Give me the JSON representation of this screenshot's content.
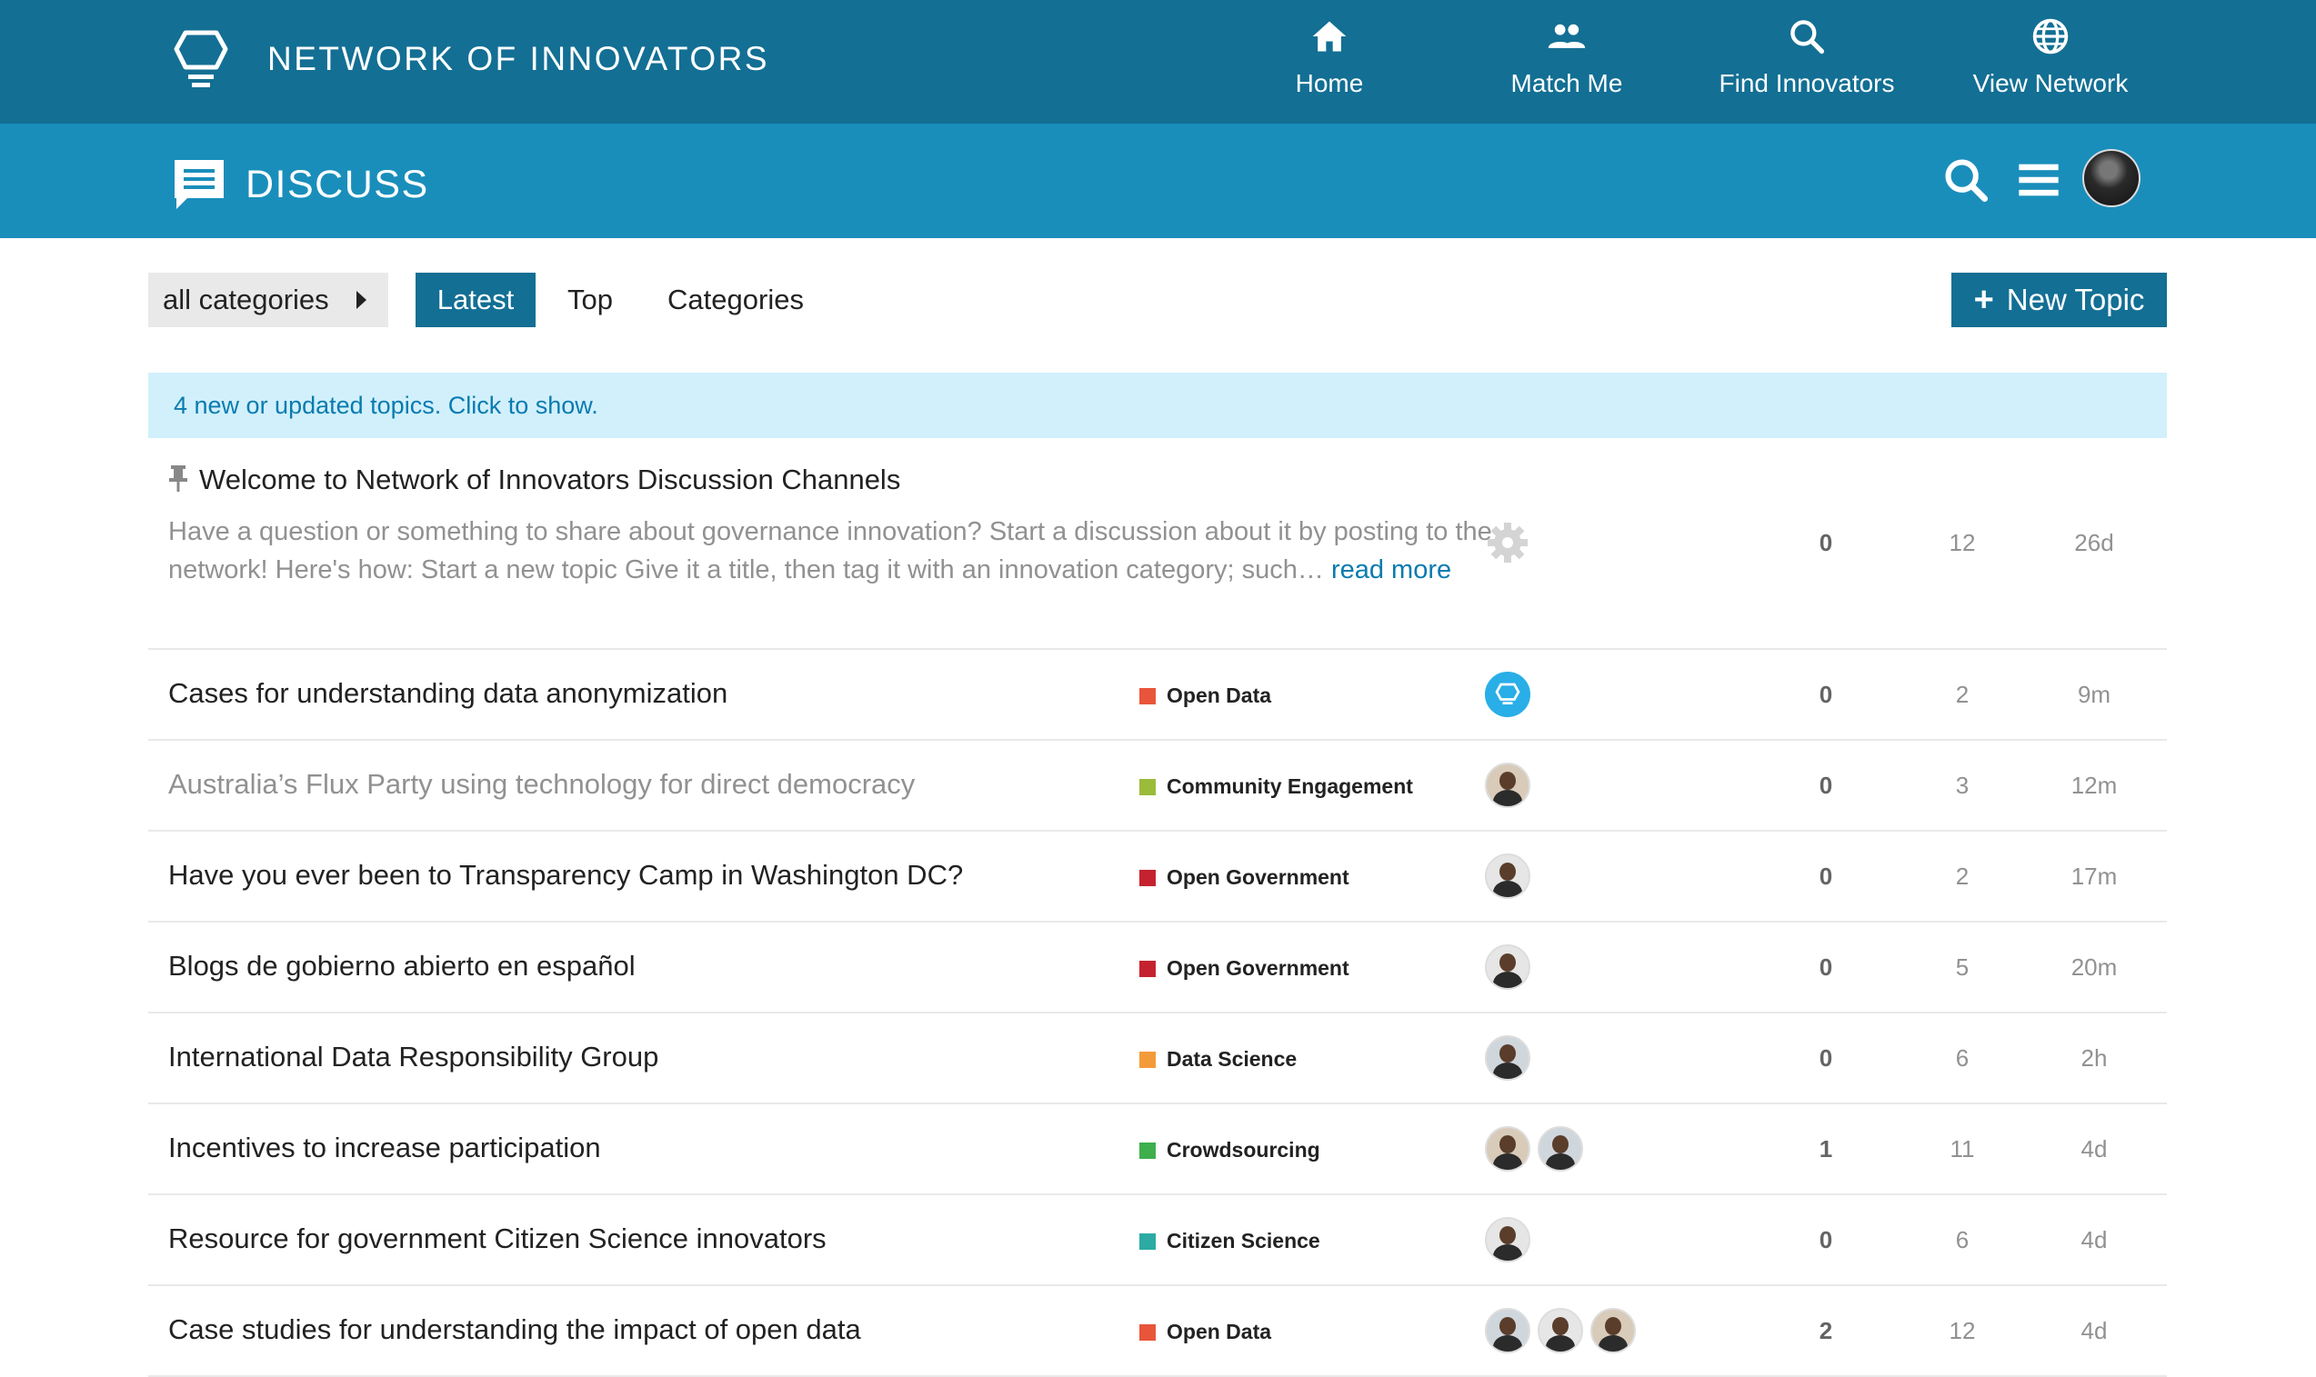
{
  "topbar": {
    "brand": "NETWORK OF INNOVATORS",
    "nav": [
      {
        "label": "Home",
        "icon": "home-icon"
      },
      {
        "label": "Match Me",
        "icon": "people-icon"
      },
      {
        "label": "Find Innovators",
        "icon": "search-icon"
      },
      {
        "label": "View Network",
        "icon": "globe-icon"
      }
    ]
  },
  "subbar": {
    "title": "DISCUSS",
    "icons": [
      "search-icon",
      "hamburger-menu-icon",
      "user-avatar"
    ]
  },
  "filters": {
    "category_dropdown": "all categories",
    "tabs": [
      "Latest",
      "Top",
      "Categories"
    ],
    "active_tab": "Latest",
    "new_topic": "New Topic"
  },
  "notice": "4 new or updated topics. Click to show.",
  "topics": [
    {
      "title": "Welcome to Network of Innovators Discussion Channels",
      "pinned": true,
      "excerpt": "Have a question or something to share about governance innovation? Start a discussion about it by posting to the network! Here's how: Start a new topic Give it a title, then tag it with an innovation category; such…",
      "read_more": "read more",
      "category": "",
      "replies": "0",
      "views": "12",
      "activity": "26d"
    },
    {
      "title": "Cases for understanding data anonymization",
      "category": "Open Data",
      "cat_color": "#e8553b",
      "replies": "0",
      "views": "2",
      "activity": "9m"
    },
    {
      "title": "Australia’s Flux Party using technology for direct democracy",
      "category": "Community Engagement",
      "cat_color": "#9bbb3a",
      "replies": "0",
      "views": "3",
      "activity": "12m",
      "visited": true
    },
    {
      "title": "Have you ever been to Transparency Camp in Washington DC?",
      "category": "Open Government",
      "cat_color": "#c4222f",
      "replies": "0",
      "views": "2",
      "activity": "17m"
    },
    {
      "title": "Blogs de gobierno abierto en español",
      "category": "Open Government",
      "cat_color": "#c4222f",
      "replies": "0",
      "views": "5",
      "activity": "20m"
    },
    {
      "title": "International Data Responsibility Group",
      "category": "Data Science",
      "cat_color": "#f39b3a",
      "replies": "0",
      "views": "6",
      "activity": "2h"
    },
    {
      "title": "Incentives to increase participation",
      "category": "Crowdsourcing",
      "cat_color": "#3eaf4c",
      "replies": "1",
      "views": "11",
      "activity": "4d"
    },
    {
      "title": "Resource for government Citizen Science innovators",
      "category": "Citizen Science",
      "cat_color": "#2baba3",
      "replies": "0",
      "views": "6",
      "activity": "4d"
    },
    {
      "title": "Case studies for understanding the impact of open data",
      "category": "Open Data",
      "cat_color": "#e8553b",
      "replies": "2",
      "views": "12",
      "activity": "4d"
    }
  ]
}
